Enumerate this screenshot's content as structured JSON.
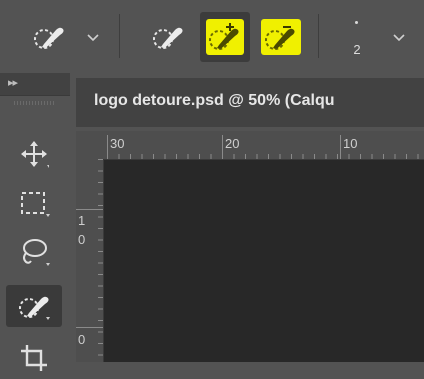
{
  "options_bar": {
    "tools": [
      {
        "icon": "quick-selection-brush-icon"
      },
      {
        "icon": "new-selection-brush-icon"
      },
      {
        "icon": "add-to-selection-brush-icon",
        "highlight": "#f0f000"
      },
      {
        "icon": "subtract-from-selection-brush-icon",
        "highlight": "#f0f000"
      }
    ],
    "brush_size": "2"
  },
  "document": {
    "tab_title": "logo detoure.psd @ 50% (Calqu"
  },
  "rulers": {
    "top_labels": [
      "30",
      "20",
      "10"
    ],
    "left_labels": [
      "1",
      "0",
      "0"
    ]
  },
  "toolbox": {
    "tools": [
      "move-icon",
      "marquee-icon",
      "lasso-icon",
      "quick-selection-icon",
      "crop-icon"
    ],
    "active_tool": "quick-selection-icon"
  },
  "colors": {
    "highlight": "#f0f000",
    "panel": "#535353",
    "canvas": "#282828"
  }
}
